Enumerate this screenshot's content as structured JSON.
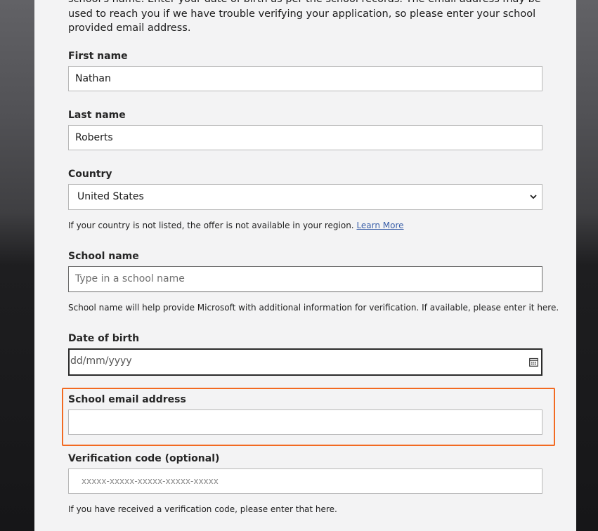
{
  "intro": {
    "text": "school's name. Enter your date of birth as per the school records. The email address may be used to reach you if we have trouble verifying your application, so please enter your school provided email address."
  },
  "form": {
    "first_name": {
      "label": "First name",
      "value": "Nathan"
    },
    "last_name": {
      "label": "Last name",
      "value": "Roberts"
    },
    "country": {
      "label": "Country",
      "value": "United States",
      "note": "If your country is not listed, the offer is not available in your region.",
      "note_link": "Learn More"
    },
    "school_name": {
      "label": "School name",
      "placeholder": "Type in a school name",
      "note": "School name will help provide Microsoft with additional information for verification. If available, please enter it here."
    },
    "date_of_birth": {
      "label": "Date of birth",
      "placeholder": "dd/mm/yyyy"
    },
    "school_email": {
      "label": "School email address",
      "value": ""
    },
    "verification_code": {
      "label": "Verification code (optional)",
      "placeholder": "xxxxx-xxxxx-xxxxx-xxxxx-xxxxx",
      "note": "If you have received a verification code, please enter that here."
    }
  },
  "colors": {
    "highlight": "#f26a21",
    "link": "#3a5fa8",
    "panel_bg": "#f3f3f4"
  }
}
